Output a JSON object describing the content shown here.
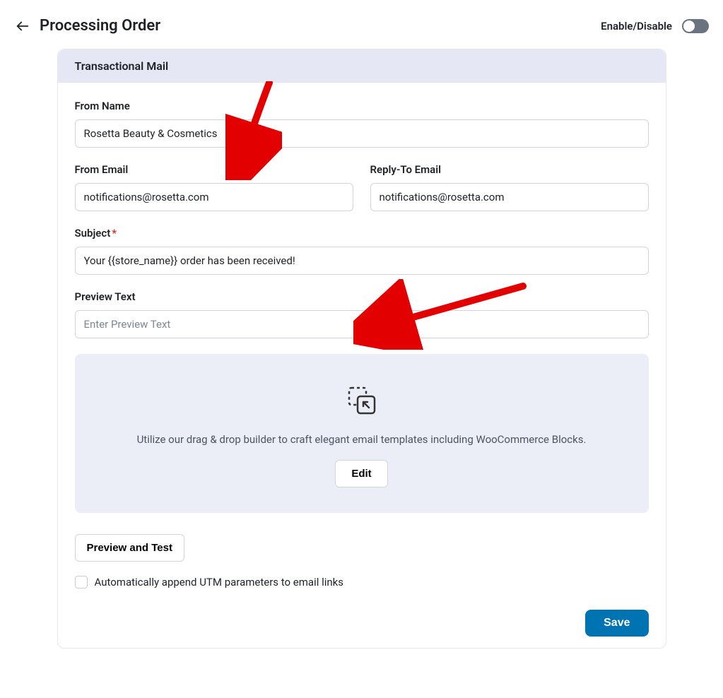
{
  "header": {
    "title": "Processing Order",
    "enable_label": "Enable/Disable"
  },
  "panel": {
    "title": "Transactional Mail"
  },
  "fields": {
    "from_name": {
      "label": "From Name",
      "value": "Rosetta Beauty & Cosmetics"
    },
    "from_email": {
      "label": "From Email",
      "value": "notifications@rosetta.com"
    },
    "reply_to": {
      "label": "Reply-To Email",
      "value": "notifications@rosetta.com"
    },
    "subject": {
      "label": "Subject",
      "value": "Your {{store_name}} order has been received!"
    },
    "preview_text": {
      "label": "Preview Text",
      "placeholder": "Enter Preview Text",
      "value": ""
    }
  },
  "builder": {
    "hint": "Utilize our drag & drop builder to craft elegant email templates including WooCommerce Blocks.",
    "edit_label": "Edit"
  },
  "preview_test_label": "Preview and Test",
  "utm_label": "Automatically append UTM parameters to email links",
  "save_label": "Save"
}
